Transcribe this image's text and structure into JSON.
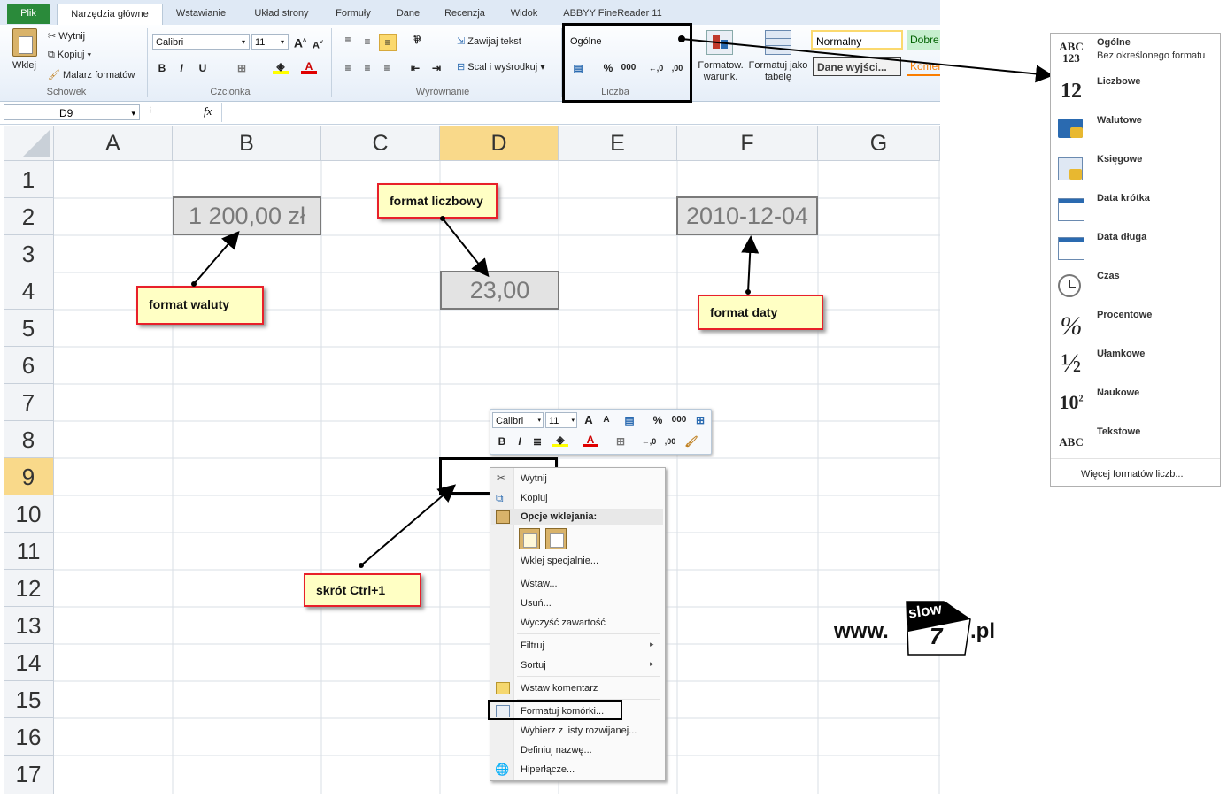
{
  "tabs": [
    "Plik",
    "Narzędzia główne",
    "Wstawianie",
    "Układ strony",
    "Formuły",
    "Dane",
    "Recenzja",
    "Widok",
    "ABBYY FineReader 11"
  ],
  "ribbon": {
    "clipboard": {
      "paste": "Wklej",
      "cut": "Wytnij",
      "copy": "Kopiuj",
      "painter": "Malarz formatów",
      "label": "Schowek"
    },
    "font": {
      "name": "Calibri",
      "size": "11",
      "label": "Czcionka",
      "bold": "B",
      "italic": "I",
      "underline": "U"
    },
    "alignment": {
      "wrap": "Zawijaj tekst",
      "merge": "Scal i wyśrodkuj",
      "label": "Wyrównanie"
    },
    "number": {
      "format": "Ogólne",
      "percent": "%",
      "thousands": "000",
      "label": "Liczba"
    },
    "styles": {
      "cond_format": "Formatow. warunk.",
      "table_format": "Formatuj jako tabelę",
      "normal": "Normalny",
      "good": "Dobre",
      "output": "Dane wyjści...",
      "comment": "Komen"
    }
  },
  "formula_bar": {
    "name_box": "D9",
    "fx": "fx"
  },
  "columns": [
    "A",
    "B",
    "C",
    "D",
    "E",
    "F",
    "G"
  ],
  "rows": [
    "1",
    "2",
    "3",
    "4",
    "5",
    "6",
    "7",
    "8",
    "9",
    "10",
    "11",
    "12",
    "13",
    "14",
    "15",
    "16",
    "17"
  ],
  "cells": {
    "b2": "1 200,00 zł",
    "d4": "23,00",
    "f2": "2010-12-04"
  },
  "callouts": {
    "currency": "format waluty",
    "number": "format liczbowy",
    "date": "format daty",
    "shortcut": "skrót Ctrl+1"
  },
  "mini_toolbar": {
    "font": "Calibri",
    "size": "11",
    "percent": "%",
    "thousands": "000"
  },
  "context_menu": {
    "cut": "Wytnij",
    "copy": "Kopiuj",
    "paste_options": "Opcje wklejania:",
    "paste_special": "Wklej specjalnie...",
    "insert": "Wstaw...",
    "delete": "Usuń...",
    "clear": "Wyczyść zawartość",
    "filter": "Filtruj",
    "sort": "Sortuj",
    "comment": "Wstaw komentarz",
    "format_cells": "Formatuj komórki...",
    "pick_list": "Wybierz z listy rozwijanej...",
    "define_name": "Definiuj nazwę...",
    "hyperlink": "Hiperłącze..."
  },
  "number_format_dropdown": {
    "items": [
      {
        "label": "Ogólne",
        "sub": "Bez określonego formatu",
        "icon": "ABC 123"
      },
      {
        "label": "Liczbowe",
        "icon": "12"
      },
      {
        "label": "Walutowe",
        "icon": "currency"
      },
      {
        "label": "Księgowe",
        "icon": "accounting"
      },
      {
        "label": "Data krótka",
        "icon": "calendar"
      },
      {
        "label": "Data długa",
        "icon": "calendar"
      },
      {
        "label": "Czas",
        "icon": "clock"
      },
      {
        "label": "Procentowe",
        "icon": "%"
      },
      {
        "label": "Ułamkowe",
        "icon": "½"
      },
      {
        "label": "Naukowe",
        "icon": "10²"
      },
      {
        "label": "Tekstowe",
        "icon": "ABC"
      }
    ],
    "more": "Więcej formatów liczb..."
  },
  "watermark": {
    "prefix": "www.",
    "logo_top": "slow",
    "logo_num": "7",
    "suffix": ".pl"
  }
}
